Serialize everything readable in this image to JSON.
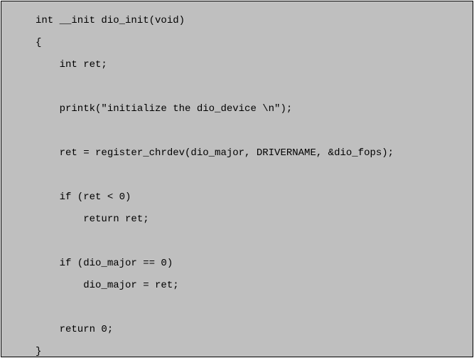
{
  "code": {
    "lines": [
      "int __init dio_init(void)",
      "{",
      "    int ret;",
      "",
      "    printk(\"initialize the dio_device \\n\");",
      "",
      "    ret = register_chrdev(dio_major, DRIVERNAME, &dio_fops);",
      "",
      "    if (ret < 0)",
      "        return ret;",
      "",
      "    if (dio_major == 0)",
      "        dio_major = ret;",
      "",
      "    return 0;",
      "}"
    ]
  }
}
